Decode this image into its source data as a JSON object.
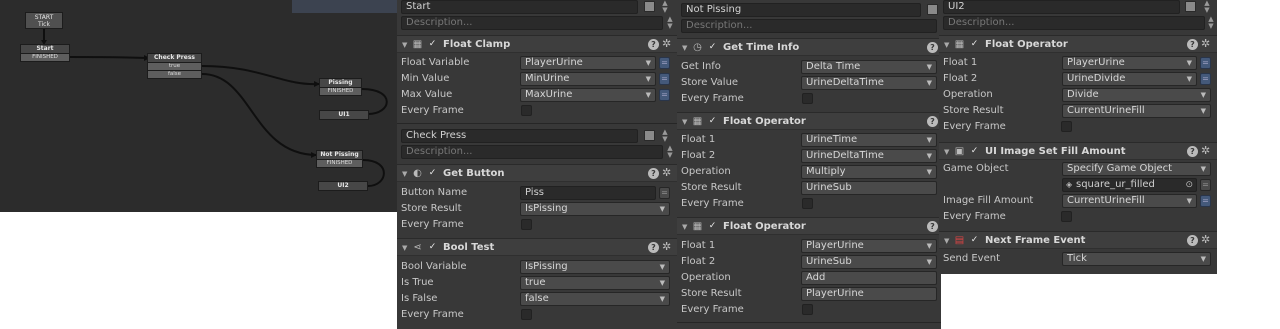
{
  "graph": {
    "start_event": {
      "title": "START",
      "event": "Tick"
    },
    "states": [
      {
        "title": "Start",
        "event": "FINISHED"
      },
      {
        "title": "Check Press",
        "events": [
          "true",
          "false"
        ]
      },
      {
        "title": "Pissing",
        "event": "FINISHED"
      },
      {
        "title": "UI1"
      },
      {
        "title": "Not Pissing",
        "event": "FINISHED"
      },
      {
        "title": "UI2"
      }
    ]
  },
  "panels": [
    {
      "states": [
        {
          "name": "Start",
          "description_placeholder": "Description...",
          "actions": [
            {
              "title": "Float Clamp",
              "icon": "calculator-icon",
              "fields": [
                {
                  "label": "Float Variable",
                  "value": "PlayerUrine"
                },
                {
                  "label": "Min Value",
                  "value": "MinUrine"
                },
                {
                  "label": "Max Value",
                  "value": "MaxUrine"
                },
                {
                  "label": "Every Frame",
                  "value": ""
                }
              ]
            }
          ]
        },
        {
          "name": "Check Press",
          "description_placeholder": "Description...",
          "actions": [
            {
              "title": "Get Button",
              "icon": "mouse-icon",
              "fields": [
                {
                  "label": "Button Name",
                  "value": "Piss"
                },
                {
                  "label": "Store Result",
                  "value": "IsPissing"
                },
                {
                  "label": "Every Frame",
                  "value": ""
                }
              ]
            },
            {
              "title": "Bool Test",
              "icon": "logic-branch-icon",
              "fields": [
                {
                  "label": "Bool Variable",
                  "value": "IsPissing"
                },
                {
                  "label": "Is True",
                  "value": "true"
                },
                {
                  "label": "Is False",
                  "value": "false"
                },
                {
                  "label": "Every Frame",
                  "value": ""
                }
              ]
            }
          ]
        }
      ]
    },
    {
      "states": [
        {
          "name": "Not Pissing",
          "description_placeholder": "Description...",
          "actions": [
            {
              "title": "Get Time Info",
              "icon": "clock-icon",
              "fields": [
                {
                  "label": "Get Info",
                  "value": "Delta Time"
                },
                {
                  "label": "Store Value",
                  "value": "UrineDeltaTime"
                },
                {
                  "label": "Every Frame",
                  "value": ""
                }
              ]
            },
            {
              "title": "Float Operator",
              "icon": "calculator-icon",
              "fields": [
                {
                  "label": "Float 1",
                  "value": "UrineTime"
                },
                {
                  "label": "Float 2",
                  "value": "UrineDeltaTime"
                },
                {
                  "label": "Operation",
                  "value": "Multiply"
                },
                {
                  "label": "Store Result",
                  "value": "UrineSub"
                },
                {
                  "label": "Every Frame",
                  "value": ""
                }
              ]
            },
            {
              "title": "Float Operator",
              "icon": "calculator-icon",
              "fields": [
                {
                  "label": "Float 1",
                  "value": "PlayerUrine"
                },
                {
                  "label": "Float 2",
                  "value": "UrineSub"
                },
                {
                  "label": "Operation",
                  "value": "Add"
                },
                {
                  "label": "Store Result",
                  "value": "PlayerUrine"
                },
                {
                  "label": "Every Frame",
                  "value": ""
                }
              ]
            }
          ]
        }
      ]
    },
    {
      "states": [
        {
          "name": "UI2",
          "description_placeholder": "Description...",
          "actions": [
            {
              "title": "Float Operator",
              "icon": "calculator-icon",
              "fields": [
                {
                  "label": "Float 1",
                  "value": "PlayerUrine"
                },
                {
                  "label": "Float 2",
                  "value": "UrineDivide"
                },
                {
                  "label": "Operation",
                  "value": "Divide"
                },
                {
                  "label": "Store Result",
                  "value": "CurrentUrineFill"
                },
                {
                  "label": "Every Frame",
                  "value": ""
                }
              ]
            },
            {
              "title": "UI Image Set Fill Amount",
              "icon": "image-icon",
              "fields": [
                {
                  "label": "Game Object",
                  "value": "Specify Game Object"
                },
                {
                  "label": "",
                  "value": "square_ur_filled"
                },
                {
                  "label": "Image Fill Amount",
                  "value": "CurrentUrineFill"
                },
                {
                  "label": "Every Frame",
                  "value": ""
                }
              ]
            },
            {
              "title": "Next Frame Event",
              "icon": "event-icon",
              "fields": [
                {
                  "label": "Send Event",
                  "value": "Tick"
                }
              ]
            }
          ]
        }
      ]
    }
  ],
  "colors": {
    "panel_bg": "#383838",
    "graph_bg": "#2c2c2c",
    "variable_button": "#44597a"
  }
}
